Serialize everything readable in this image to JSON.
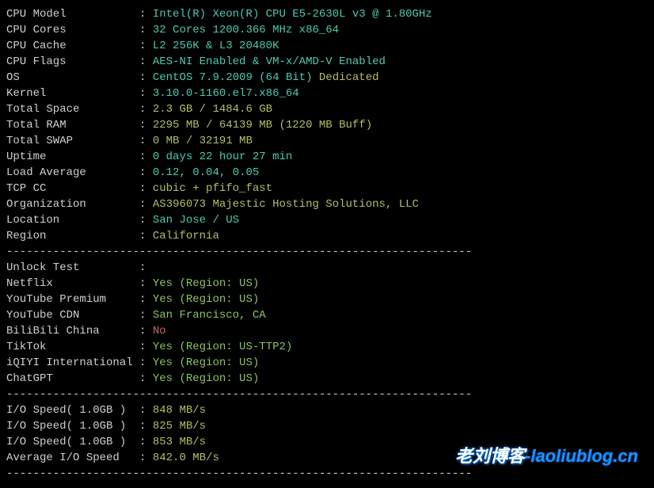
{
  "divider": "----------------------------------------------------------------------",
  "sysinfo": [
    {
      "label": "CPU Model",
      "value": "Intel(R) Xeon(R) CPU E5-2630L v3 @ 1.80GHz",
      "cls": "cyan"
    },
    {
      "label": "CPU Cores",
      "value": "32 Cores 1200.366 MHz x86_64",
      "cls": "cyan"
    },
    {
      "label": "CPU Cache",
      "value": "L2 256K & L3 20480K",
      "cls": "cyan"
    },
    {
      "label": "CPU Flags",
      "value": "AES-NI Enabled & VM-x/AMD-V Enabled",
      "cls": "cyan"
    },
    {
      "label": "OS",
      "value": "CentOS 7.9.2009 (64 Bit)",
      "extra": " Dedicated",
      "cls": "cyan",
      "extracls": "olive"
    },
    {
      "label": "Kernel",
      "value": "3.10.0-1160.el7.x86_64",
      "cls": "cyan"
    },
    {
      "label": "Total Space",
      "value": "2.3 GB / 1484.6 GB",
      "cls": "olive"
    },
    {
      "label": "Total RAM",
      "value": "2295 MB / 64139 MB (1220 MB Buff)",
      "cls": "olive"
    },
    {
      "label": "Total SWAP",
      "value": "0 MB / 32191 MB",
      "cls": "olive"
    },
    {
      "label": "Uptime",
      "value": "0 days 22 hour 27 min",
      "cls": "cyan"
    },
    {
      "label": "Load Average",
      "value": "0.12, 0.04, 0.05",
      "cls": "cyan"
    },
    {
      "label": "TCP CC",
      "value": "cubic + pfifo_fast",
      "cls": "olive"
    },
    {
      "label": "Organization",
      "value": "AS396073 Majestic Hosting Solutions, LLC",
      "cls": "olive"
    },
    {
      "label": "Location",
      "value": "San Jose / US",
      "cls": "cyan"
    },
    {
      "label": "Region",
      "value": "California",
      "cls": "olive"
    }
  ],
  "unlock_header": {
    "label": "Unlock Test",
    "value": ""
  },
  "unlock": [
    {
      "label": "Netflix",
      "value": "Yes (Region: US)",
      "cls": "green"
    },
    {
      "label": "YouTube Premium",
      "value": "Yes (Region: US)",
      "cls": "green"
    },
    {
      "label": "YouTube CDN",
      "value": "San Francisco, CA",
      "cls": "green"
    },
    {
      "label": "BiliBili China",
      "value": "No",
      "cls": "red"
    },
    {
      "label": "TikTok",
      "value": "Yes (Region: US-TTP2)",
      "cls": "green"
    },
    {
      "label": "iQIYI International",
      "value": "Yes (Region: US)",
      "cls": "green"
    },
    {
      "label": "ChatGPT",
      "value": "Yes (Region: US)",
      "cls": "green"
    }
  ],
  "io": [
    {
      "label": "I/O Speed( 1.0GB )",
      "value": "848 MB/s",
      "cls": "olive"
    },
    {
      "label": "I/O Speed( 1.0GB )",
      "value": "825 MB/s",
      "cls": "olive"
    },
    {
      "label": "I/O Speed( 1.0GB )",
      "value": "853 MB/s",
      "cls": "olive"
    },
    {
      "label": "Average I/O Speed",
      "value": "842.0 MB/s",
      "cls": "olive"
    }
  ],
  "watermark": {
    "part1": "老刘博客",
    "part2": "-laoliublog.cn"
  }
}
